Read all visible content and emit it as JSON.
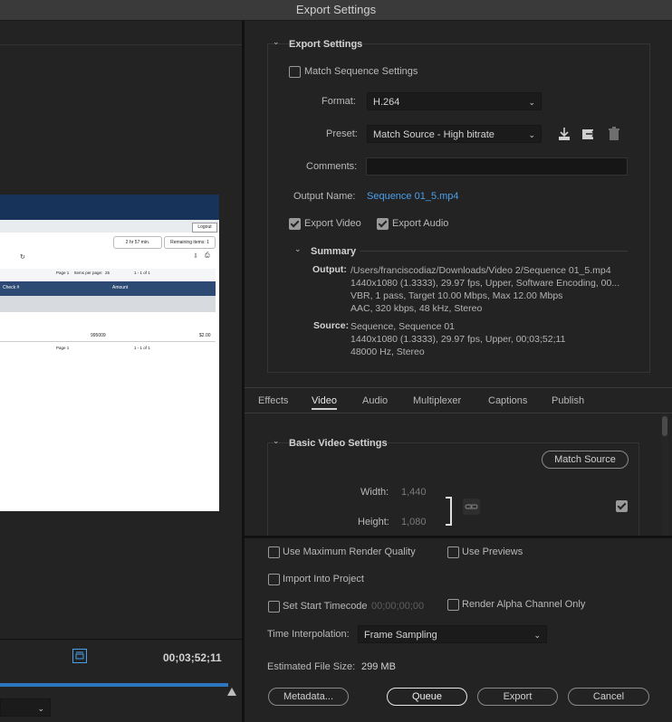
{
  "window": {
    "title": "Export Settings"
  },
  "export_settings": {
    "header": "Export Settings",
    "match_sequence_label": "Match Sequence Settings",
    "format_label": "Format:",
    "format_value": "H.264",
    "preset_label": "Preset:",
    "preset_value": "Match Source - High bitrate",
    "comments_label": "Comments:",
    "comments_value": "",
    "output_name_label": "Output Name:",
    "output_name_value": "Sequence 01_5.mp4",
    "export_video_label": "Export Video",
    "export_audio_label": "Export Audio",
    "summary_header": "Summary",
    "output_label": "Output:",
    "output_lines": [
      "/Users/franciscodiaz/Downloads/Video 2/Sequence 01_5.mp4",
      "1440x1080 (1.3333), 29.97 fps, Upper, Software Encoding, 00...",
      "VBR, 1 pass, Target 10.00 Mbps, Max 12.00 Mbps",
      "AAC, 320 kbps, 48 kHz, Stereo"
    ],
    "source_label": "Source:",
    "source_lines": [
      "Sequence, Sequence 01",
      "1440x1080 (1.3333), 29.97 fps, Upper, 00;03;52;11",
      "48000 Hz, Stereo"
    ]
  },
  "tabs": [
    {
      "label": "Effects"
    },
    {
      "label": "Video"
    },
    {
      "label": "Audio"
    },
    {
      "label": "Multiplexer"
    },
    {
      "label": "Captions"
    },
    {
      "label": "Publish"
    }
  ],
  "video_settings": {
    "header": "Basic Video Settings",
    "match_source_label": "Match Source",
    "width_label": "Width:",
    "width_value": "1,440",
    "height_label": "Height:",
    "height_value": "1,080"
  },
  "bottom": {
    "max_render_label": "Use Maximum Render Quality",
    "use_previews_label": "Use Previews",
    "import_label": "Import Into Project",
    "start_timecode_label": "Set Start Timecode",
    "start_timecode_value": "00;00;00;00",
    "alpha_label": "Render Alpha Channel Only",
    "interp_label": "Time Interpolation:",
    "interp_value": "Frame Sampling",
    "filesize_label": "Estimated File Size:",
    "filesize_value": "299 MB",
    "metadata_label": "Metadata...",
    "queue_label": "Queue",
    "export_label": "Export",
    "cancel_label": "Cancel"
  },
  "preview": {
    "timecode": "00;03;52;11",
    "thumb": {
      "logout": "Logout",
      "timer": "2 hr 57 min.",
      "remaining": "Remaining items: 1",
      "page": "Page 1",
      "items_per_page": "Items per page:",
      "per_page_value": "25",
      "range": "1 - 1 of 1",
      "col_check": "Check #",
      "col_amount": "Amount",
      "row_check": "995009",
      "row_amount": "$2.00"
    }
  }
}
